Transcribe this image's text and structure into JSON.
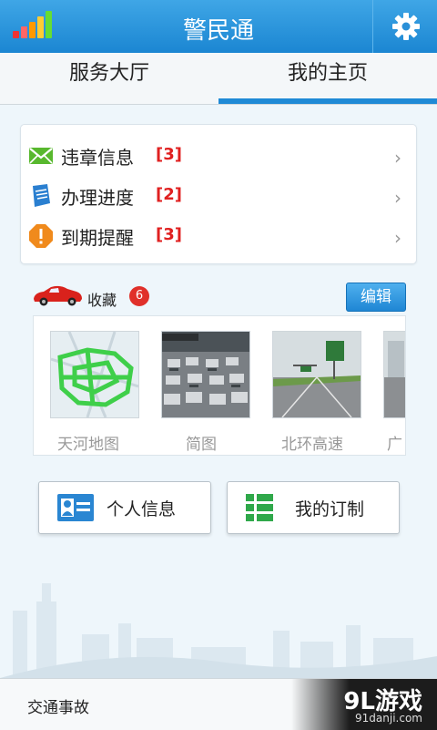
{
  "header": {
    "title": "警民通",
    "settings_icon": "gear-icon",
    "signal_icon": "signal-bars-icon"
  },
  "tabs": [
    {
      "label": "服务大厅",
      "active": false
    },
    {
      "label": "我的主页",
      "active": true
    }
  ],
  "notifications": [
    {
      "label": "违章信息",
      "count": "[3]",
      "icon": "envelope-icon"
    },
    {
      "label": "办理进度",
      "count": "[2]",
      "icon": "document-icon"
    },
    {
      "label": "到期提醒",
      "count": "[3]",
      "icon": "alert-icon"
    }
  ],
  "favorites": {
    "label": "收藏",
    "badge": "6",
    "edit_label": "编辑",
    "items": [
      {
        "caption": "天河地图"
      },
      {
        "caption": "简图"
      },
      {
        "caption": "北环高速"
      },
      {
        "caption": "广"
      }
    ]
  },
  "buttons": {
    "personal_info": "个人信息",
    "my_custom": "我的订制"
  },
  "bottom": {
    "text": "交通事故"
  },
  "watermark": {
    "brand": "9L游戏",
    "url": "91danji.com"
  },
  "colors": {
    "accent": "#1f8ad6",
    "badge": "#e0302a",
    "count_red": "#e02020"
  }
}
